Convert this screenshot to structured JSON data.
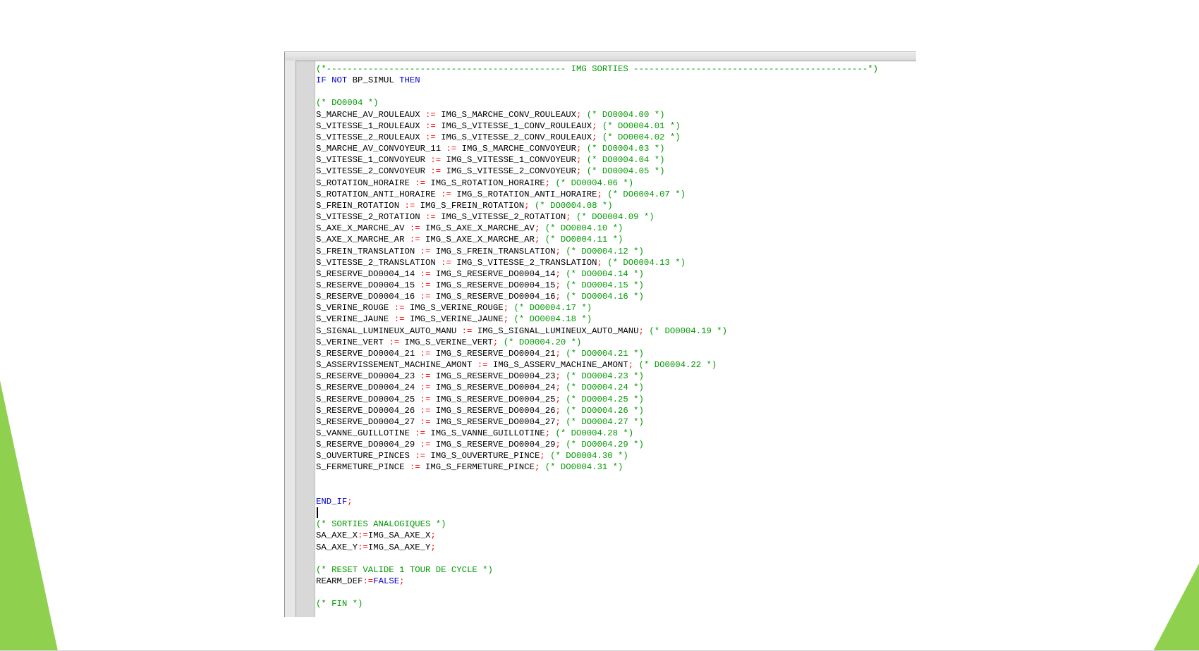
{
  "colors": {
    "keyword": "#0000cc",
    "comment": "#009900",
    "operator": "#ff0000",
    "identifier": "#000000",
    "slide_accent": "#8fd14f"
  },
  "editor": {
    "lines": [
      [
        {
          "t": "comment",
          "v": "(*---------------------------------------------- IMG SORTIES ---------------------------------------------*)"
        }
      ],
      [
        {
          "t": "kw",
          "v": "IF"
        },
        {
          "t": "ident",
          "v": " "
        },
        {
          "t": "kw",
          "v": "NOT"
        },
        {
          "t": "ident",
          "v": " BP_SIMUL "
        },
        {
          "t": "kw",
          "v": "THEN"
        }
      ],
      [],
      [
        {
          "t": "comment",
          "v": "(* DO0004 *)"
        }
      ],
      [
        {
          "t": "ident",
          "v": "S_MARCHE_AV_ROULEAUX "
        },
        {
          "t": "op",
          "v": ":="
        },
        {
          "t": "ident",
          "v": " IMG_S_MARCHE_CONV_ROULEAUX"
        },
        {
          "t": "op",
          "v": ";"
        },
        {
          "t": "ident",
          "v": " "
        },
        {
          "t": "comment",
          "v": "(* DO0004.00 *)"
        }
      ],
      [
        {
          "t": "ident",
          "v": "S_VITESSE_1_ROULEAUX "
        },
        {
          "t": "op",
          "v": ":="
        },
        {
          "t": "ident",
          "v": " IMG_S_VITESSE_1_CONV_ROULEAUX"
        },
        {
          "t": "op",
          "v": ";"
        },
        {
          "t": "ident",
          "v": " "
        },
        {
          "t": "comment",
          "v": "(* DO0004.01 *)"
        }
      ],
      [
        {
          "t": "ident",
          "v": "S_VITESSE_2_ROULEAUX "
        },
        {
          "t": "op",
          "v": ":="
        },
        {
          "t": "ident",
          "v": " IMG_S_VITESSE_2_CONV_ROULEAUX"
        },
        {
          "t": "op",
          "v": ";"
        },
        {
          "t": "ident",
          "v": " "
        },
        {
          "t": "comment",
          "v": "(* DO0004.02 *)"
        }
      ],
      [
        {
          "t": "ident",
          "v": "S_MARCHE_AV_CONVOYEUR_11 "
        },
        {
          "t": "op",
          "v": ":="
        },
        {
          "t": "ident",
          "v": " IMG_S_MARCHE_CONVOYEUR"
        },
        {
          "t": "op",
          "v": ";"
        },
        {
          "t": "ident",
          "v": " "
        },
        {
          "t": "comment",
          "v": "(* DO0004.03 *)"
        }
      ],
      [
        {
          "t": "ident",
          "v": "S_VITESSE_1_CONVOYEUR "
        },
        {
          "t": "op",
          "v": ":="
        },
        {
          "t": "ident",
          "v": " IMG_S_VITESSE_1_CONVOYEUR"
        },
        {
          "t": "op",
          "v": ";"
        },
        {
          "t": "ident",
          "v": " "
        },
        {
          "t": "comment",
          "v": "(* DO0004.04 *)"
        }
      ],
      [
        {
          "t": "ident",
          "v": "S_VITESSE_2_CONVOYEUR "
        },
        {
          "t": "op",
          "v": ":="
        },
        {
          "t": "ident",
          "v": " IMG_S_VITESSE_2_CONVOYEUR"
        },
        {
          "t": "op",
          "v": ";"
        },
        {
          "t": "ident",
          "v": " "
        },
        {
          "t": "comment",
          "v": "(* DO0004.05 *)"
        }
      ],
      [
        {
          "t": "ident",
          "v": "S_ROTATION_HORAIRE "
        },
        {
          "t": "op",
          "v": ":="
        },
        {
          "t": "ident",
          "v": " IMG_S_ROTATION_HORAIRE"
        },
        {
          "t": "op",
          "v": ";"
        },
        {
          "t": "ident",
          "v": " "
        },
        {
          "t": "comment",
          "v": "(* DO0004.06 *)"
        }
      ],
      [
        {
          "t": "ident",
          "v": "S_ROTATION_ANTI_HORAIRE "
        },
        {
          "t": "op",
          "v": ":="
        },
        {
          "t": "ident",
          "v": " IMG_S_ROTATION_ANTI_HORAIRE"
        },
        {
          "t": "op",
          "v": ";"
        },
        {
          "t": "ident",
          "v": " "
        },
        {
          "t": "comment",
          "v": "(* DO0004.07 *)"
        }
      ],
      [
        {
          "t": "ident",
          "v": "S_FREIN_ROTATION "
        },
        {
          "t": "op",
          "v": ":="
        },
        {
          "t": "ident",
          "v": " IMG_S_FREIN_ROTATION"
        },
        {
          "t": "op",
          "v": ";"
        },
        {
          "t": "ident",
          "v": " "
        },
        {
          "t": "comment",
          "v": "(* DO0004.08 *)"
        }
      ],
      [
        {
          "t": "ident",
          "v": "S_VITESSE_2_ROTATION "
        },
        {
          "t": "op",
          "v": ":="
        },
        {
          "t": "ident",
          "v": " IMG_S_VITESSE_2_ROTATION"
        },
        {
          "t": "op",
          "v": ";"
        },
        {
          "t": "ident",
          "v": " "
        },
        {
          "t": "comment",
          "v": "(* DO0004.09 *)"
        }
      ],
      [
        {
          "t": "ident",
          "v": "S_AXE_X_MARCHE_AV "
        },
        {
          "t": "op",
          "v": ":="
        },
        {
          "t": "ident",
          "v": " IMG_S_AXE_X_MARCHE_AV"
        },
        {
          "t": "op",
          "v": ";"
        },
        {
          "t": "ident",
          "v": " "
        },
        {
          "t": "comment",
          "v": "(* DO0004.10 *)"
        }
      ],
      [
        {
          "t": "ident",
          "v": "S_AXE_X_MARCHE_AR "
        },
        {
          "t": "op",
          "v": ":="
        },
        {
          "t": "ident",
          "v": " IMG_S_AXE_X_MARCHE_AR"
        },
        {
          "t": "op",
          "v": ";"
        },
        {
          "t": "ident",
          "v": " "
        },
        {
          "t": "comment",
          "v": "(* DO0004.11 *)"
        }
      ],
      [
        {
          "t": "ident",
          "v": "S_FREIN_TRANSLATION "
        },
        {
          "t": "op",
          "v": ":="
        },
        {
          "t": "ident",
          "v": " IMG_S_FREIN_TRANSLATION"
        },
        {
          "t": "op",
          "v": ";"
        },
        {
          "t": "ident",
          "v": " "
        },
        {
          "t": "comment",
          "v": "(* DO0004.12 *)"
        }
      ],
      [
        {
          "t": "ident",
          "v": "S_VITESSE_2_TRANSLATION "
        },
        {
          "t": "op",
          "v": ":="
        },
        {
          "t": "ident",
          "v": " IMG_S_VITESSE_2_TRANSLATION"
        },
        {
          "t": "op",
          "v": ";"
        },
        {
          "t": "ident",
          "v": " "
        },
        {
          "t": "comment",
          "v": "(* DO0004.13 *)"
        }
      ],
      [
        {
          "t": "ident",
          "v": "S_RESERVE_DO0004_14 "
        },
        {
          "t": "op",
          "v": ":="
        },
        {
          "t": "ident",
          "v": " IMG_S_RESERVE_DO0004_14"
        },
        {
          "t": "op",
          "v": ";"
        },
        {
          "t": "ident",
          "v": " "
        },
        {
          "t": "comment",
          "v": "(* DO0004.14 *)"
        }
      ],
      [
        {
          "t": "ident",
          "v": "S_RESERVE_DO0004_15 "
        },
        {
          "t": "op",
          "v": ":="
        },
        {
          "t": "ident",
          "v": " IMG_S_RESERVE_DO0004_15"
        },
        {
          "t": "op",
          "v": ";"
        },
        {
          "t": "ident",
          "v": " "
        },
        {
          "t": "comment",
          "v": "(* DO0004.15 *)"
        }
      ],
      [
        {
          "t": "ident",
          "v": "S_RESERVE_DO0004_16 "
        },
        {
          "t": "op",
          "v": ":="
        },
        {
          "t": "ident",
          "v": " IMG_S_RESERVE_DO0004_16"
        },
        {
          "t": "op",
          "v": ";"
        },
        {
          "t": "ident",
          "v": " "
        },
        {
          "t": "comment",
          "v": "(* DO0004.16 *)"
        }
      ],
      [
        {
          "t": "ident",
          "v": "S_VERINE_ROUGE "
        },
        {
          "t": "op",
          "v": ":="
        },
        {
          "t": "ident",
          "v": " IMG_S_VERINE_ROUGE"
        },
        {
          "t": "op",
          "v": ";"
        },
        {
          "t": "ident",
          "v": " "
        },
        {
          "t": "comment",
          "v": "(* DO0004.17 *)"
        }
      ],
      [
        {
          "t": "ident",
          "v": "S_VERINE_JAUNE "
        },
        {
          "t": "op",
          "v": ":="
        },
        {
          "t": "ident",
          "v": " IMG_S_VERINE_JAUNE"
        },
        {
          "t": "op",
          "v": ";"
        },
        {
          "t": "ident",
          "v": " "
        },
        {
          "t": "comment",
          "v": "(* DO0004.18 *)"
        }
      ],
      [
        {
          "t": "ident",
          "v": "S_SIGNAL_LUMINEUX_AUTO_MANU "
        },
        {
          "t": "op",
          "v": ":="
        },
        {
          "t": "ident",
          "v": " IMG_S_SIGNAL_LUMINEUX_AUTO_MANU"
        },
        {
          "t": "op",
          "v": ";"
        },
        {
          "t": "ident",
          "v": " "
        },
        {
          "t": "comment",
          "v": "(* DO0004.19 *)"
        }
      ],
      [
        {
          "t": "ident",
          "v": "S_VERINE_VERT "
        },
        {
          "t": "op",
          "v": ":="
        },
        {
          "t": "ident",
          "v": " IMG_S_VERINE_VERT"
        },
        {
          "t": "op",
          "v": ";"
        },
        {
          "t": "ident",
          "v": " "
        },
        {
          "t": "comment",
          "v": "(* DO0004.20 *)"
        }
      ],
      [
        {
          "t": "ident",
          "v": "S_RESERVE_DO0004_21 "
        },
        {
          "t": "op",
          "v": ":="
        },
        {
          "t": "ident",
          "v": " IMG_S_RESERVE_DO0004_21"
        },
        {
          "t": "op",
          "v": ";"
        },
        {
          "t": "ident",
          "v": " "
        },
        {
          "t": "comment",
          "v": "(* DO0004.21 *)"
        }
      ],
      [
        {
          "t": "ident",
          "v": "S_ASSERVISSEMENT_MACHINE_AMONT "
        },
        {
          "t": "op",
          "v": ":="
        },
        {
          "t": "ident",
          "v": " IMG_S_ASSERV_MACHINE_AMONT"
        },
        {
          "t": "op",
          "v": ";"
        },
        {
          "t": "ident",
          "v": " "
        },
        {
          "t": "comment",
          "v": "(* DO0004.22 *)"
        }
      ],
      [
        {
          "t": "ident",
          "v": "S_RESERVE_DO0004_23 "
        },
        {
          "t": "op",
          "v": ":="
        },
        {
          "t": "ident",
          "v": " IMG_S_RESERVE_DO0004_23"
        },
        {
          "t": "op",
          "v": ";"
        },
        {
          "t": "ident",
          "v": " "
        },
        {
          "t": "comment",
          "v": "(* DO0004.23 *)"
        }
      ],
      [
        {
          "t": "ident",
          "v": "S_RESERVE_DO0004_24 "
        },
        {
          "t": "op",
          "v": ":="
        },
        {
          "t": "ident",
          "v": " IMG_S_RESERVE_DO0004_24"
        },
        {
          "t": "op",
          "v": ";"
        },
        {
          "t": "ident",
          "v": " "
        },
        {
          "t": "comment",
          "v": "(* DO0004.24 *)"
        }
      ],
      [
        {
          "t": "ident",
          "v": "S_RESERVE_DO0004_25 "
        },
        {
          "t": "op",
          "v": ":="
        },
        {
          "t": "ident",
          "v": " IMG_S_RESERVE_DO0004_25"
        },
        {
          "t": "op",
          "v": ";"
        },
        {
          "t": "ident",
          "v": " "
        },
        {
          "t": "comment",
          "v": "(* DO0004.25 *)"
        }
      ],
      [
        {
          "t": "ident",
          "v": "S_RESERVE_DO0004_26 "
        },
        {
          "t": "op",
          "v": ":="
        },
        {
          "t": "ident",
          "v": " IMG_S_RESERVE_DO0004_26"
        },
        {
          "t": "op",
          "v": ";"
        },
        {
          "t": "ident",
          "v": " "
        },
        {
          "t": "comment",
          "v": "(* DO0004.26 *)"
        }
      ],
      [
        {
          "t": "ident",
          "v": "S_RESERVE_DO0004_27 "
        },
        {
          "t": "op",
          "v": ":="
        },
        {
          "t": "ident",
          "v": " IMG_S_RESERVE_DO0004_27"
        },
        {
          "t": "op",
          "v": ";"
        },
        {
          "t": "ident",
          "v": " "
        },
        {
          "t": "comment",
          "v": "(* DO0004.27 *)"
        }
      ],
      [
        {
          "t": "ident",
          "v": "S_VANNE_GUILLOTINE "
        },
        {
          "t": "op",
          "v": ":="
        },
        {
          "t": "ident",
          "v": " IMG_S_VANNE_GUILLOTINE"
        },
        {
          "t": "op",
          "v": ";"
        },
        {
          "t": "ident",
          "v": " "
        },
        {
          "t": "comment",
          "v": "(* DO0004.28 *)"
        }
      ],
      [
        {
          "t": "ident",
          "v": "S_RESERVE_DO0004_29 "
        },
        {
          "t": "op",
          "v": ":="
        },
        {
          "t": "ident",
          "v": " IMG_S_RESERVE_DO0004_29"
        },
        {
          "t": "op",
          "v": ";"
        },
        {
          "t": "ident",
          "v": " "
        },
        {
          "t": "comment",
          "v": "(* DO0004.29 *)"
        }
      ],
      [
        {
          "t": "ident",
          "v": "S_OUVERTURE_PINCES "
        },
        {
          "t": "op",
          "v": ":="
        },
        {
          "t": "ident",
          "v": " IMG_S_OUVERTURE_PINCE"
        },
        {
          "t": "op",
          "v": ";"
        },
        {
          "t": "ident",
          "v": " "
        },
        {
          "t": "comment",
          "v": "(* DO0004.30 *)"
        }
      ],
      [
        {
          "t": "ident",
          "v": "S_FERMETURE_PINCE "
        },
        {
          "t": "op",
          "v": ":="
        },
        {
          "t": "ident",
          "v": " IMG_S_FERMETURE_PINCE"
        },
        {
          "t": "op",
          "v": ";"
        },
        {
          "t": "ident",
          "v": " "
        },
        {
          "t": "comment",
          "v": "(* DO0004.31 *)"
        }
      ],
      [],
      [],
      [
        {
          "t": "kw",
          "v": "END_IF"
        },
        {
          "t": "op",
          "v": ";"
        }
      ],
      [
        {
          "t": "caret",
          "v": ""
        }
      ],
      [
        {
          "t": "comment",
          "v": "(* SORTIES ANALOGIQUES *)"
        }
      ],
      [
        {
          "t": "ident",
          "v": "SA_AXE_X"
        },
        {
          "t": "op",
          "v": ":="
        },
        {
          "t": "ident",
          "v": "IMG_SA_AXE_X"
        },
        {
          "t": "op",
          "v": ";"
        }
      ],
      [
        {
          "t": "ident",
          "v": "SA_AXE_Y"
        },
        {
          "t": "op",
          "v": ":="
        },
        {
          "t": "ident",
          "v": "IMG_SA_AXE_Y"
        },
        {
          "t": "op",
          "v": ";"
        }
      ],
      [],
      [
        {
          "t": "comment",
          "v": "(* RESET VALIDE 1 TOUR DE CYCLE *)"
        }
      ],
      [
        {
          "t": "ident",
          "v": "REARM_DEF"
        },
        {
          "t": "op",
          "v": ":="
        },
        {
          "t": "kw",
          "v": "FALSE"
        },
        {
          "t": "op",
          "v": ";"
        }
      ],
      [],
      [
        {
          "t": "comment",
          "v": "(* FIN *)"
        }
      ]
    ]
  }
}
